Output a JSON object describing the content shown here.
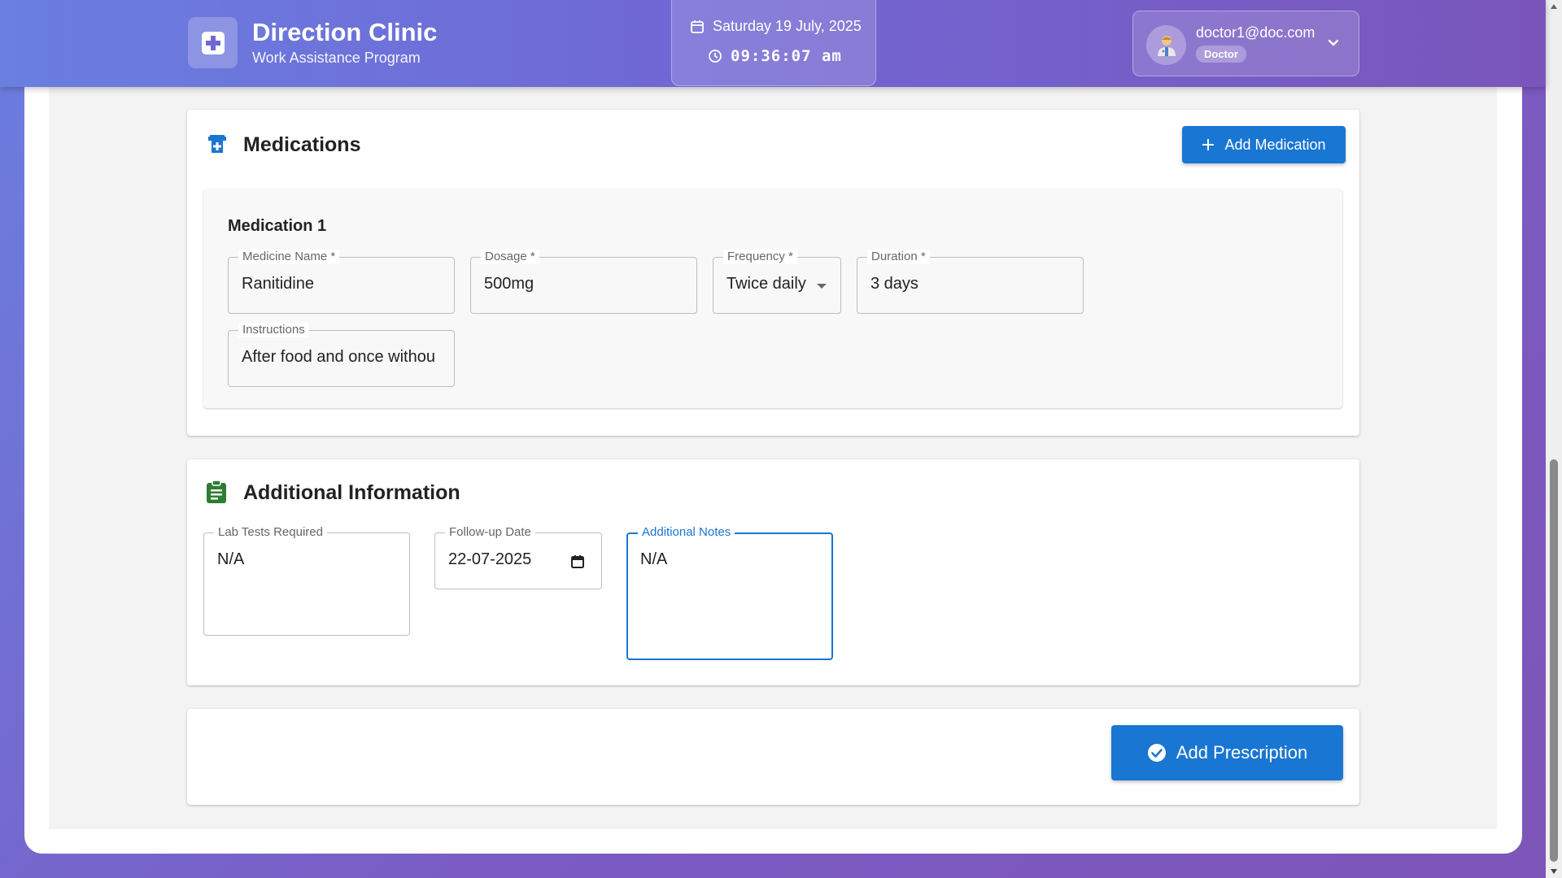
{
  "header": {
    "brand_title": "Direction Clinic",
    "brand_subtitle": "Work Assistance Program",
    "date": "Saturday 19 July, 2025",
    "time": "09:36:07 am",
    "user_email": "doctor1@doc.com",
    "user_role": "Doctor"
  },
  "medications": {
    "title": "Medications",
    "add_button_label": "Add Medication",
    "items": [
      {
        "heading": "Medication 1",
        "medicine_name_label": "Medicine Name *",
        "medicine_name": "Ranitidine",
        "dosage_label": "Dosage *",
        "dosage": "500mg",
        "frequency_label": "Frequency *",
        "frequency": "Twice daily",
        "duration_label": "Duration *",
        "duration": "3 days",
        "instructions_label": "Instructions",
        "instructions": "After food and once withou"
      }
    ]
  },
  "additional_info": {
    "title": "Additional Information",
    "lab_tests_label": "Lab Tests Required",
    "lab_tests": "N/A",
    "followup_label": "Follow-up Date",
    "followup_date": "22-07-2025",
    "notes_label": "Additional Notes",
    "notes": "N/A"
  },
  "actions": {
    "submit_label": "Add Prescription"
  },
  "colors": {
    "primary": "#1976d2",
    "medication_icon": "#1976d2",
    "info_icon": "#2e7d32"
  },
  "icons": {
    "brand": "medical-cross-icon",
    "date": "calendar-icon",
    "time": "clock-icon",
    "avatar": "doctor-avatar-icon",
    "user_menu": "chevron-down-icon",
    "medications": "medication-icon",
    "add": "plus-icon",
    "info": "clipboard-icon",
    "date_picker": "calendar-picker-icon",
    "submit": "check-circle-icon"
  }
}
